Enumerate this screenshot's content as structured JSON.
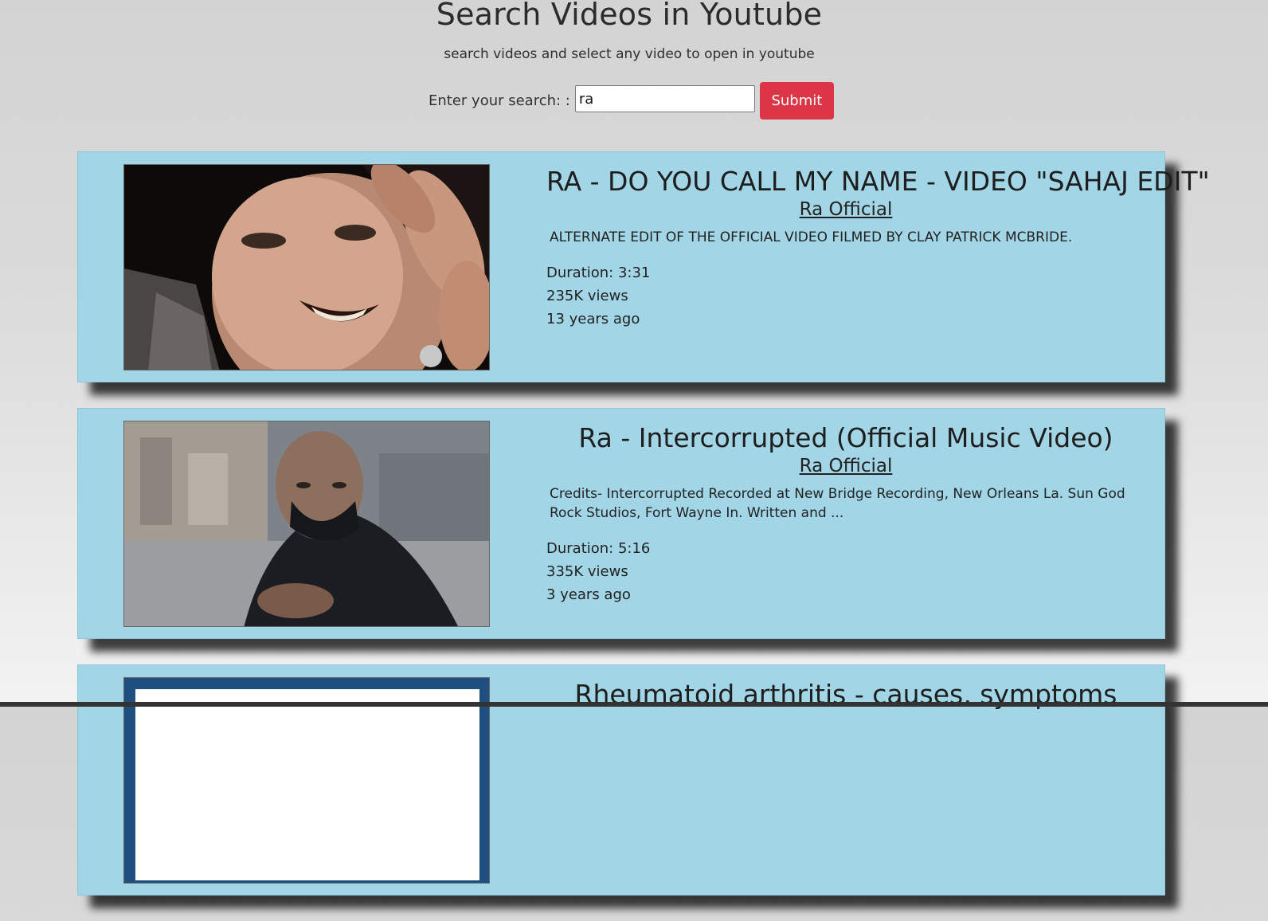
{
  "header": {
    "title": "Search Videos in Youtube",
    "subtitle": "search videos and select any video to open in youtube"
  },
  "search": {
    "label": "Enter your search: :",
    "value": "ra",
    "submit_label": "Submit"
  },
  "results": [
    {
      "title": "RA - DO YOU CALL MY NAME - VIDEO \"SAHAJ EDIT\"",
      "channel": "Ra Official",
      "description": "ALTERNATE EDIT OF THE OFFICIAL VIDEO FILMED BY CLAY PATRICK MCBRIDE.",
      "duration": "Duration: 3:31",
      "views": "235K views",
      "age": "13 years ago"
    },
    {
      "title": "Ra - Intercorrupted (Official Music Video)",
      "channel": "Ra Official",
      "description": "Credits- Intercorrupted Recorded at New Bridge Recording, New Orleans La. Sun God Rock Studios, Fort Wayne In. Written and ...",
      "duration": "Duration: 5:16",
      "views": "335K views",
      "age": "3 years ago"
    },
    {
      "title": "Rheumatoid arthritis - causes, symptoms"
    }
  ],
  "colors": {
    "card_bg": "#a2d6e6",
    "submit_bg": "#dc3545"
  }
}
